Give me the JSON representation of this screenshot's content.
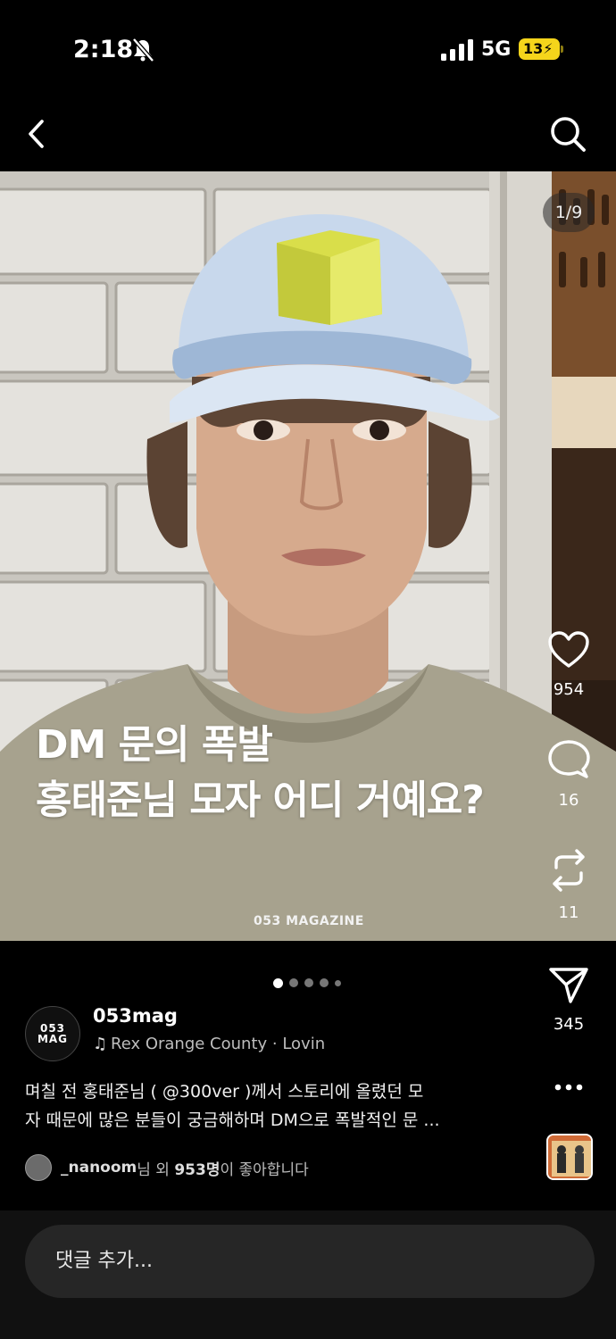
{
  "status_bar": {
    "time": "2:18",
    "network": "5G",
    "battery": "13"
  },
  "media": {
    "counter": "1/9",
    "headline_line1": "DM 문의 폭발",
    "headline_line2": "홍태준님 모자 어디 거예요?",
    "watermark": "053 MAGAZINE"
  },
  "actions": {
    "likes": "954",
    "comments": "16",
    "reposts": "11",
    "shares": "345"
  },
  "carousel": {
    "total_dots": 5,
    "active_index": 0
  },
  "post": {
    "avatar_line1": "053",
    "avatar_line2": "MAG",
    "username": "053mag",
    "music": "Rex Orange County · Lovin",
    "caption_line1": "며칠 전 홍태준님 ( @300ver )께서 스토리에 올렸던 모",
    "caption_line2": "자 때문에 많은 분들이 궁금해하며 DM으로 폭발적인 문 ...",
    "liked_by_user": "_nanoom",
    "liked_by_mid": "님 외 ",
    "liked_by_count": "953명",
    "liked_by_suffix": "이 좋아합니다"
  },
  "comment": {
    "placeholder": "댓글 추가..."
  },
  "icons": [
    "bell-slash-icon",
    "signal-icon",
    "back-icon",
    "search-icon",
    "heart-icon",
    "comment-icon",
    "repost-icon",
    "send-icon",
    "more-icon",
    "music-note-icon"
  ]
}
